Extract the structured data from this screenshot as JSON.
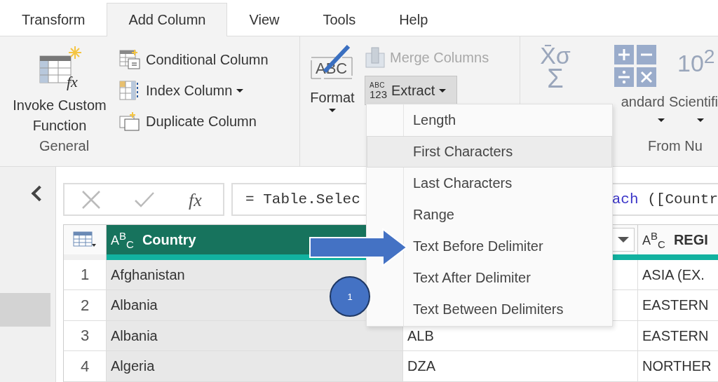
{
  "tabs": [
    {
      "label": "Transform",
      "selected": false
    },
    {
      "label": "Add Column",
      "selected": true
    },
    {
      "label": "View",
      "selected": false
    },
    {
      "label": "Tools",
      "selected": false
    },
    {
      "label": "Help",
      "selected": false
    }
  ],
  "ribbon": {
    "general": {
      "label": "General",
      "big_button": {
        "label_lines": [
          "Invoke Custom",
          "Function"
        ],
        "icon_text": "fx"
      },
      "items": [
        {
          "label": "Conditional Column",
          "kind": "conditional",
          "dropdown": false
        },
        {
          "label": "Index Column",
          "kind": "index",
          "dropdown": true
        },
        {
          "label": "Duplicate Column",
          "kind": "duplicate",
          "dropdown": false
        }
      ]
    },
    "text_group": {
      "format_button": {
        "label": "Format",
        "icon_text": "ABC"
      },
      "merge_button": {
        "label": "Merge Columns",
        "disabled": true
      },
      "extract_button": {
        "label": "Extract",
        "icon_text": [
          "ABC",
          "123"
        ],
        "expanded": true
      }
    },
    "number_group": {
      "label": "From Nu",
      "buttons": [
        {
          "kind": "statistics",
          "icon_text": [
            "X̄σ",
            "Σ"
          ]
        },
        {
          "kind": "standard",
          "label": "andard"
        },
        {
          "kind": "scientific",
          "icon_text": "10$^{2}$",
          "label": "Scientifi"
        }
      ]
    }
  },
  "formula": {
    "function_label": "fx",
    "parts": [
      {
        "text": "= Table.Selec",
        "kind": "plain"
      },
      {
        "text": "ach",
        "kind": "keyword"
      },
      {
        "text": " ([Countr",
        "kind": "plain"
      }
    ]
  },
  "table": {
    "columns": [
      {
        "type_label": "A$^{B}$$_{C}$",
        "name": "Country",
        "selected": true
      },
      {
        "kind": "dropdown_only"
      },
      {
        "type_label": "A$^{B}$$_{C}$",
        "name": "REGI",
        "selected": false
      }
    ],
    "rows": [
      {
        "number": "1",
        "country": "Afghanistan",
        "region": "ASIA (EX."
      },
      {
        "number": "2",
        "country": "Albania",
        "region": "EASTERN"
      },
      {
        "number": "3",
        "country": "Albania",
        "code": "ALB",
        "region": "EASTERN"
      },
      {
        "number": "4",
        "country": "Algeria",
        "code": "DZA",
        "region": "NORTHER"
      }
    ]
  },
  "extract_menu": {
    "items": [
      {
        "label": "Length",
        "highlighted": false
      },
      {
        "label": "First Characters",
        "highlighted": true
      },
      {
        "label": "Last Characters",
        "highlighted": false
      },
      {
        "label": "Range",
        "highlighted": false
      },
      {
        "label": "Text Before Delimiter",
        "highlighted": false
      },
      {
        "label": "Text After Delimiter",
        "highlighted": false
      },
      {
        "label": "Text Between Delimiters",
        "highlighted": false
      }
    ]
  },
  "annotation": {
    "label": "1"
  }
}
